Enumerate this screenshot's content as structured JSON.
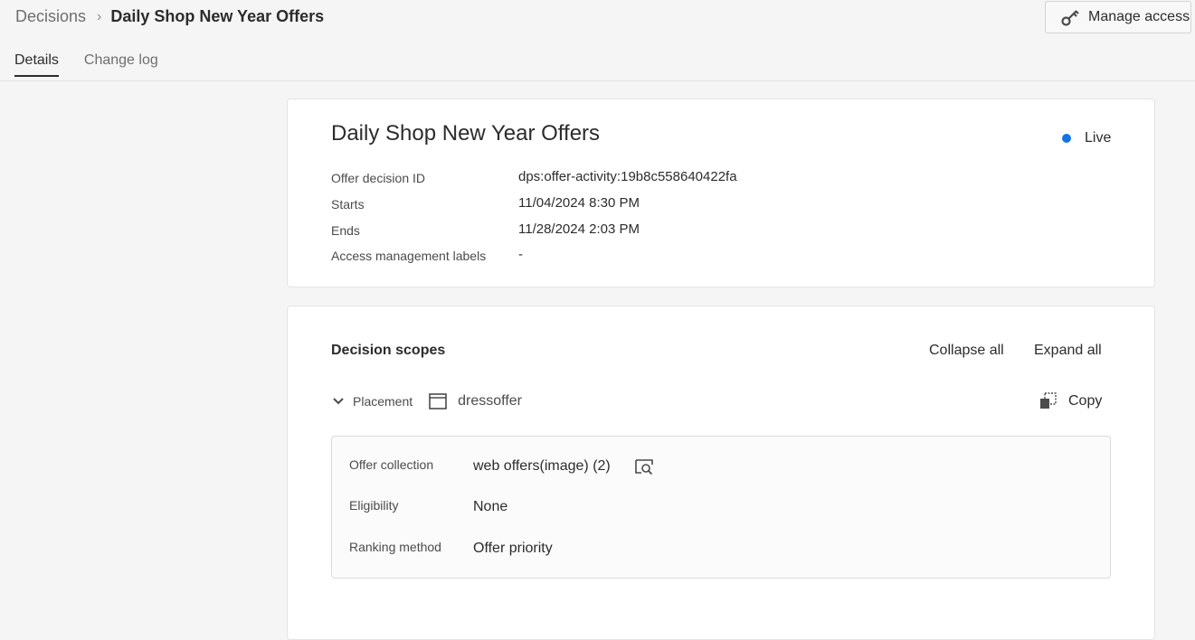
{
  "breadcrumb": {
    "parent": "Decisions",
    "separator": "›",
    "current": "Daily Shop New Year Offers"
  },
  "header": {
    "manage_access_label": "Manage access"
  },
  "tabs": [
    {
      "label": "Details",
      "active": true
    },
    {
      "label": "Change log",
      "active": false
    }
  ],
  "offer": {
    "title": "Daily Shop New Year Offers",
    "status": "Live",
    "status_color": "#1473e6",
    "fields": [
      {
        "label": "Offer decision ID",
        "value": "dps:offer-activity:19b8c558640422fa"
      },
      {
        "label": "Starts",
        "value": "11/04/2024 8:30 PM"
      },
      {
        "label": "Ends",
        "value": "11/28/2024 2:03 PM"
      },
      {
        "label": "Access management labels",
        "value": "-"
      }
    ]
  },
  "scopes": {
    "title": "Decision scopes",
    "collapse_all": "Collapse all",
    "expand_all": "Expand all",
    "placement_label": "Placement",
    "placement_name": "dressoffer",
    "copy_label": "Copy",
    "properties": [
      {
        "label": "Offer collection",
        "value": "web offers(image) (2)"
      },
      {
        "label": "Eligibility",
        "value": "None"
      },
      {
        "label": "Ranking method",
        "value": "Offer priority"
      }
    ]
  }
}
